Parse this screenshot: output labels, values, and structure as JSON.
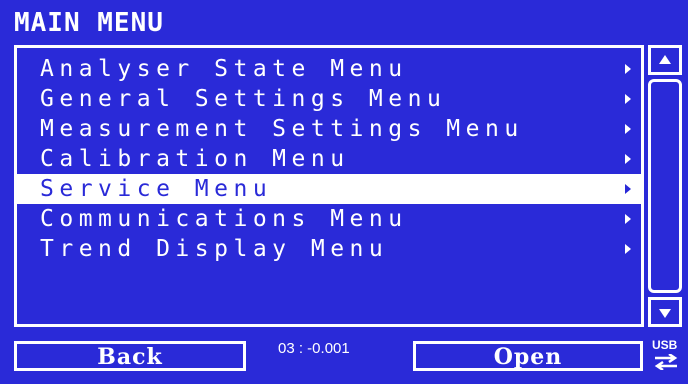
{
  "title": "MAIN MENU",
  "menu": {
    "items": [
      {
        "label": "Analyser State Menu",
        "selected": false
      },
      {
        "label": "General Settings Menu",
        "selected": false
      },
      {
        "label": "Measurement Settings Menu",
        "selected": false
      },
      {
        "label": "Calibration Menu",
        "selected": false
      },
      {
        "label": "Service Menu",
        "selected": true
      },
      {
        "label": "Communications Menu",
        "selected": false
      },
      {
        "label": "Trend Display Menu",
        "selected": false
      }
    ],
    "submenu_indicator_icon": "arrow-right-icon"
  },
  "scrollbar": {
    "up_icon": "arrow-up-icon",
    "down_icon": "arrow-down-icon"
  },
  "softkeys": {
    "back_label": "Back",
    "open_label": "Open"
  },
  "status": {
    "readout": "03 : -0.001",
    "usb_label": "USB",
    "usb_icon": "usb-transfer-icon"
  },
  "colors": {
    "screen_background": "#2a2ad8",
    "foreground": "#ffffff",
    "selected_background": "#ffffff",
    "selected_text": "#2a2ad8"
  }
}
